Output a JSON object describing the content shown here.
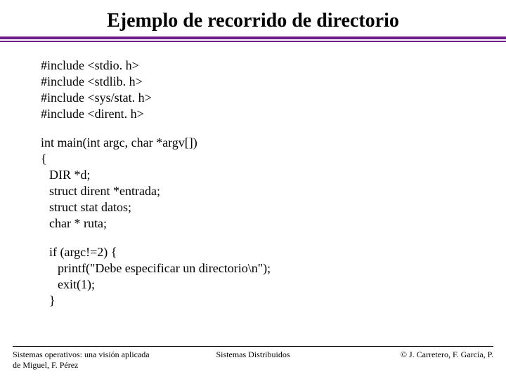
{
  "title": "Ejemplo de recorrido de directorio",
  "code": {
    "l1": "#include <stdio. h>",
    "l2": "#include <stdlib. h>",
    "l3": "#include <sys/stat. h>",
    "l4": "#include <dirent. h>",
    "l5": "int main(int argc, char *argv[])",
    "l6": "{",
    "l7": "DIR *d;",
    "l8": "struct dirent *entrada;",
    "l9": "struct stat datos;",
    "l10": "char * ruta;",
    "l11": "if (argc!=2) {",
    "l12": "printf(\"Debe especificar un directorio\\n\");",
    "l13": "exit(1);",
    "l14": "}"
  },
  "footer": {
    "left_line1": "Sistemas operativos: una visión aplicada",
    "left_line2": "de Miguel, F. Pérez",
    "center": "Sistemas Distribuidos",
    "right": "© J. Carretero, F. García, P."
  }
}
